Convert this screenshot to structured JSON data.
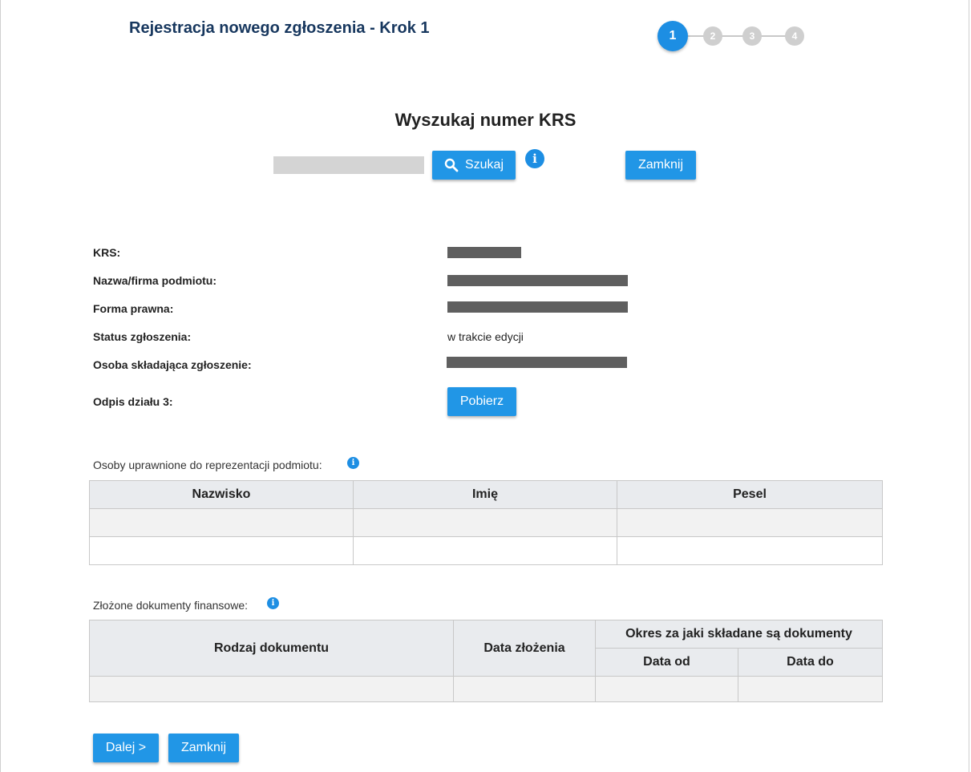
{
  "header": {
    "title": "Rejestracja nowego zgłoszenia - Krok 1",
    "steps": [
      "1",
      "2",
      "3",
      "4"
    ],
    "active_step": "1"
  },
  "search": {
    "heading": "Wyszukaj numer KRS",
    "input_value": "",
    "search_label": "Szukaj",
    "close_label": "Zamknij",
    "info_symbol": "i"
  },
  "details": {
    "krs_label": "KRS:",
    "name_label": "Nazwa/firma podmiotu:",
    "legal_form_label": "Forma prawna:",
    "status_label": "Status zgłoszenia:",
    "status_value": "w trakcie edycji",
    "submitter_label": "Osoba składająca zgłoszenie:",
    "extract_label": "Odpis działu 3:",
    "download_label": "Pobierz"
  },
  "representatives": {
    "label": "Osoby uprawnione do reprezentacji podmiotu:",
    "columns": [
      "Nazwisko",
      "Imię",
      "Pesel"
    ]
  },
  "documents": {
    "label": "Złożone dokumenty finansowe:",
    "col_type": "Rodzaj dokumentu",
    "col_date": "Data złożenia",
    "col_period": "Okres za jaki składane są dokumenty",
    "col_from": "Data od",
    "col_to": "Data do"
  },
  "footer": {
    "next_label": "Dalej >",
    "close_label": "Zamknij"
  },
  "colors": {
    "accent": "#2196e6",
    "title": "#17375e",
    "step_inactive": "#cfcfcf",
    "redaction": "#5f5f5f"
  }
}
